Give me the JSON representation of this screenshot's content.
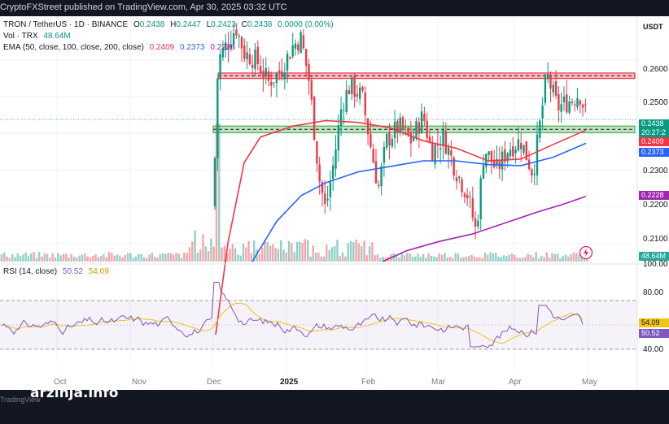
{
  "header": {
    "publisher_line": "CryptoFXStreet published on TradingView.com, Apr 30, 2025 03:32 UTC"
  },
  "legend": {
    "symbol": "TRON / TetherUS · 1D · BINANCE",
    "ohlc": [
      {
        "key": "O",
        "value": "0.2438"
      },
      {
        "key": "H",
        "value": "0.2447"
      },
      {
        "key": "L",
        "value": "0.2423"
      },
      {
        "key": "C",
        "value": "0.2438"
      }
    ],
    "change": "0.0000 (0.00%)",
    "vol_label": "Vol · TRX",
    "vol_value": "48.64M",
    "ema_label": "EMA (50, close, 100, close, 200, close)",
    "ema_values": [
      "0.2409",
      "0.2373",
      "0.2228"
    ],
    "rsi_label": "RSI (14, close)",
    "rsi_values": [
      "50.52",
      "54.09"
    ]
  },
  "price_axis": {
    "currency": "USDT",
    "ticks": [
      "0.2600",
      "0.2500",
      "0.2300",
      "0.2200",
      "0.2100"
    ],
    "current_price": "0.2438",
    "countdown": "20:27:2",
    "volume_tag": "48.64M"
  },
  "rsi_axis": {
    "ticks": [
      "100.00",
      "80.00",
      "40.00"
    ],
    "rsi_tag": "50.52",
    "ma_tag": "54.09"
  },
  "time_axis": {
    "labels": [
      "Oct",
      "Nov",
      "Dec",
      "2025",
      "Feb",
      "Mar",
      "Apr",
      "May"
    ]
  },
  "watermark": {
    "brand": "ARZINJA",
    "url": "arzinja.info",
    "tv_logo": "TradingView"
  },
  "colors": {
    "up": "#089981",
    "down": "#f23645",
    "ema50": "#f23645",
    "ema100": "#2962ff",
    "ema200": "#9c27b0",
    "rsi": "#7e57c2",
    "rsi_ma": "#f0c419",
    "resistance_zone": "#f23645",
    "support_zone": "#4caf50"
  },
  "chart_data": {
    "type": "candlestick",
    "symbol": "TRON / TetherUS",
    "interval": "1D",
    "exchange": "BINANCE",
    "y_range": [
      0.205,
      0.272
    ],
    "zones": [
      {
        "type": "resistance",
        "from": 0.255,
        "to": 0.2565
      },
      {
        "type": "support",
        "from": 0.2402,
        "to": 0.242
      }
    ],
    "ema": [
      {
        "period": 50,
        "last": 0.2409,
        "path": [
          [
            265,
            0.185
          ],
          [
            280,
            0.21
          ],
          [
            300,
            0.232
          ],
          [
            320,
            0.239
          ],
          [
            360,
            0.242
          ],
          [
            400,
            0.2435
          ],
          [
            440,
            0.243
          ],
          [
            480,
            0.2415
          ],
          [
            520,
            0.238
          ],
          [
            560,
            0.236
          ],
          [
            600,
            0.2325
          ],
          [
            640,
            0.233
          ],
          [
            680,
            0.237
          ],
          [
            720,
            0.2409
          ]
        ]
      },
      {
        "period": 100,
        "last": 0.2373,
        "path": [
          [
            310,
            0.205
          ],
          [
            340,
            0.216
          ],
          [
            370,
            0.223
          ],
          [
            400,
            0.2265
          ],
          [
            440,
            0.2295
          ],
          [
            480,
            0.231
          ],
          [
            520,
            0.2325
          ],
          [
            560,
            0.2325
          ],
          [
            600,
            0.2315
          ],
          [
            640,
            0.2312
          ],
          [
            680,
            0.2335
          ],
          [
            720,
            0.2373
          ]
        ]
      },
      {
        "period": 200,
        "last": 0.2228,
        "path": [
          [
            470,
            0.205
          ],
          [
            500,
            0.208
          ],
          [
            540,
            0.2105
          ],
          [
            580,
            0.2125
          ],
          [
            620,
            0.2155
          ],
          [
            660,
            0.2185
          ],
          [
            690,
            0.2205
          ],
          [
            720,
            0.2228
          ]
        ]
      }
    ],
    "volume_last": "48.64M",
    "rsi": {
      "period": 14,
      "last": 50.52,
      "ma_last": 54.09,
      "upper": 70,
      "lower": 30
    }
  }
}
